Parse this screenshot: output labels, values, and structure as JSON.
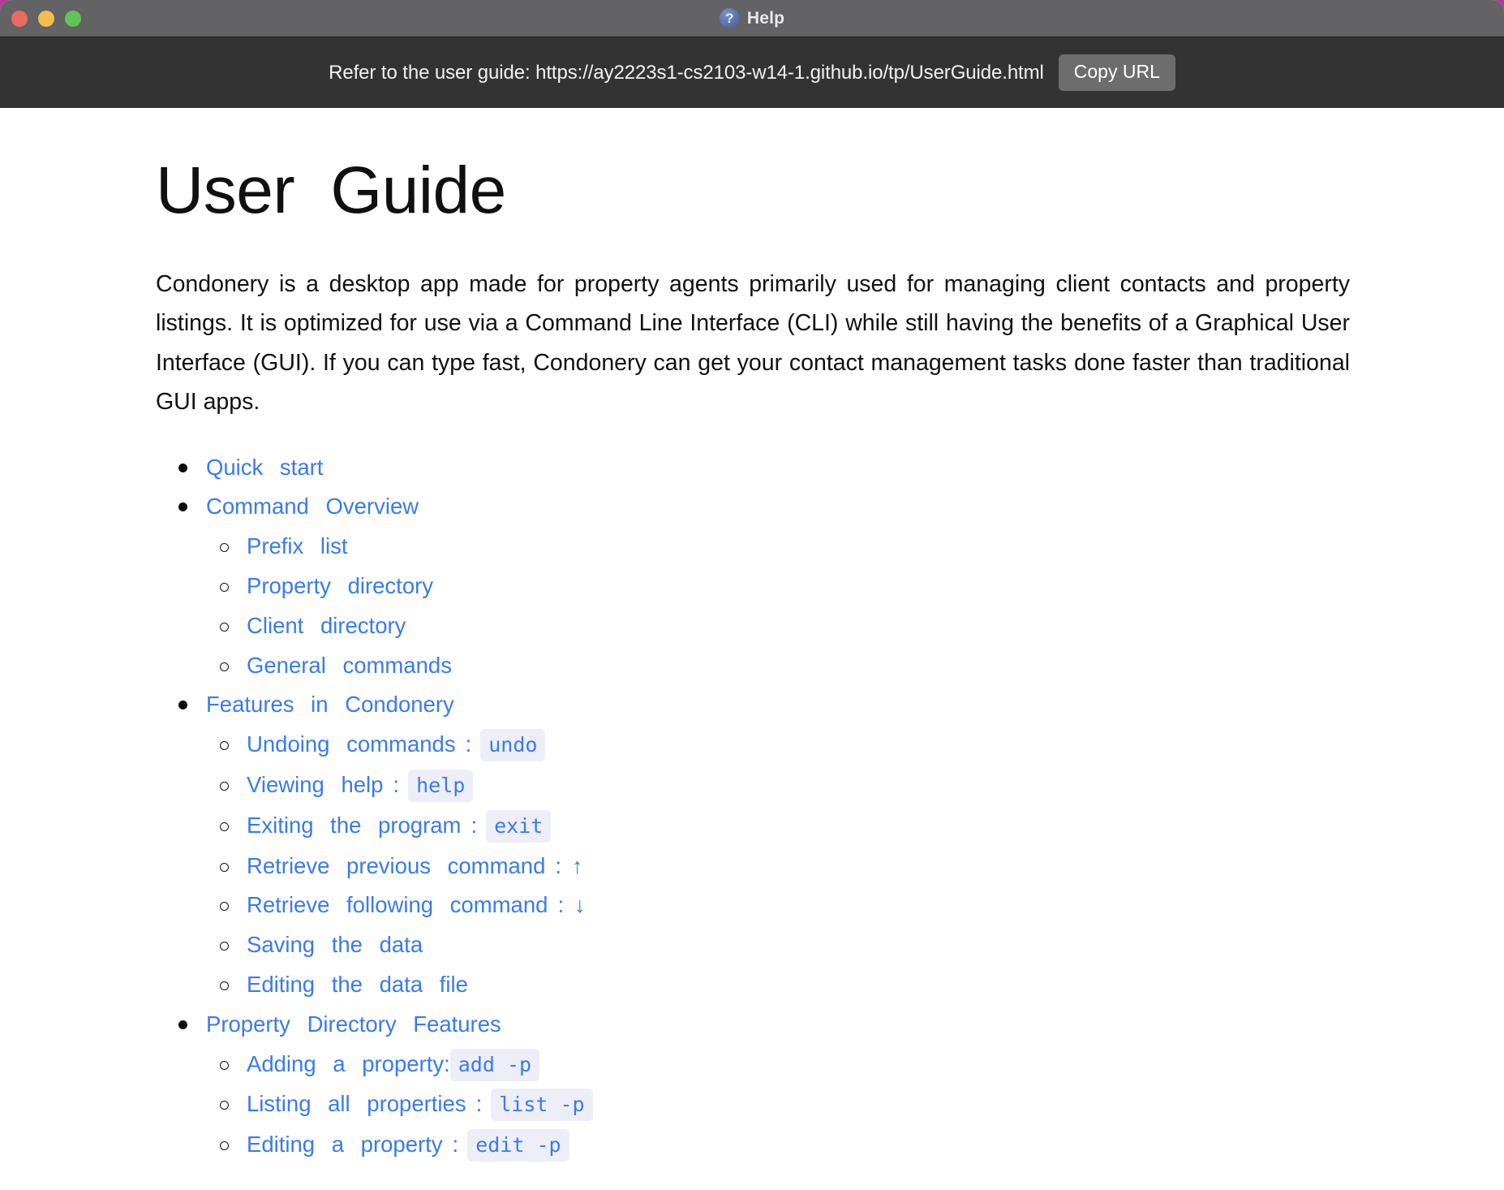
{
  "window": {
    "title": "Help",
    "help_icon": "question-mark-circle-icon",
    "traffic_lights": {
      "close": "close-window-button",
      "minimize": "minimize-window-button",
      "maximize": "maximize-window-button",
      "close_color": "#ec6a5f",
      "minimize_color": "#f4bd4f",
      "maximize_color": "#61c554"
    },
    "titlebar_color": "#636264"
  },
  "toolbar": {
    "url_text": "Refer to the user guide: https://ay2223s1-cs2103-w14-1.github.io/tp/UserGuide.html",
    "copy_label": "Copy URL",
    "background_color": "#333333",
    "button_color": "#6d6d6d"
  },
  "document": {
    "title": "User  Guide",
    "intro": "Condonery is a desktop app made for property agents primarily used for managing client contacts and property listings. It is optimized for use via a Command Line Interface (CLI) while still having the benefits of a Graphical User Interface (GUI). If you can type fast, Condonery can get your contact management tasks done faster than traditional GUI apps.",
    "link_color": "#3a7bed",
    "code_bg_color": "#eeeef8",
    "toc": [
      {
        "label": "Quick start"
      },
      {
        "label": "Command Overview",
        "children": [
          {
            "label": "Prefix list"
          },
          {
            "label": "Property directory"
          },
          {
            "label": "Client directory"
          },
          {
            "label": "General commands"
          }
        ]
      },
      {
        "label": "Features in Condonery",
        "children": [
          {
            "label": "Undoing commands",
            "sep": ":",
            "code": "undo"
          },
          {
            "label": "Viewing help",
            "sep": ":",
            "code": "help"
          },
          {
            "label": "Exiting the program",
            "sep": ":",
            "code": "exit"
          },
          {
            "label": "Retrieve previous command",
            "sep": ":",
            "arrow": "↑"
          },
          {
            "label": "Retrieve following command",
            "sep": ":",
            "arrow": "↓"
          },
          {
            "label": "Saving the data"
          },
          {
            "label": "Editing the data file"
          }
        ]
      },
      {
        "label": "Property Directory Features",
        "children": [
          {
            "label": "Adding a property:",
            "code": "add -p"
          },
          {
            "label": "Listing all properties",
            "sep": ":",
            "code": "list -p"
          },
          {
            "label": "Editing a property",
            "sep": ":",
            "code": "edit -p"
          }
        ]
      }
    ]
  }
}
